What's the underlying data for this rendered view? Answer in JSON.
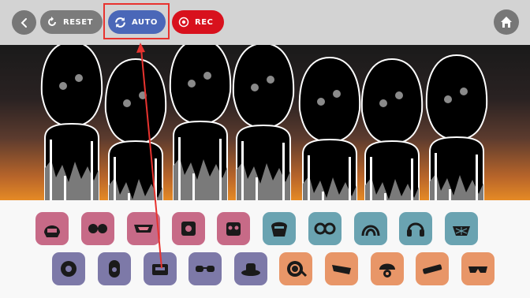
{
  "toolbar": {
    "back_icon": "chevron-left-icon",
    "reset_label": "RESET",
    "auto_label": "AUTO",
    "rec_label": "REC",
    "home_icon": "home-icon"
  },
  "colors": {
    "toolbar_bg": "#d3d3d3",
    "reset_btn": "#7b7b7b",
    "auto_btn": "#4a67b8",
    "rec_btn": "#d8111d",
    "annotation": "#e8332f"
  },
  "characters": 7,
  "palette": {
    "row1": [
      {
        "icon": "helmet-icon",
        "color": "pink"
      },
      {
        "icon": "goggles-icon",
        "color": "pink"
      },
      {
        "icon": "visor-icon",
        "color": "pink"
      },
      {
        "icon": "gear-face-icon",
        "color": "pink"
      },
      {
        "icon": "robot-face-icon",
        "color": "pink"
      },
      {
        "icon": "mask-icon",
        "color": "teal"
      },
      {
        "icon": "swim-goggles-icon",
        "color": "teal"
      },
      {
        "icon": "wave-hood-icon",
        "color": "teal"
      },
      {
        "icon": "headphones-icon",
        "color": "teal"
      },
      {
        "icon": "mesh-mask-icon",
        "color": "teal"
      }
    ],
    "row2": [
      {
        "icon": "round-head-icon",
        "color": "purple"
      },
      {
        "icon": "capsule-head-icon",
        "color": "purple"
      },
      {
        "icon": "box-head-icon",
        "color": "purple"
      },
      {
        "icon": "glasses-icon",
        "color": "purple"
      },
      {
        "icon": "hat-icon",
        "color": "purple"
      },
      {
        "icon": "speaker-head-icon",
        "color": "orange"
      },
      {
        "icon": "shades-icon",
        "color": "orange"
      },
      {
        "icon": "cap-icon",
        "color": "orange"
      },
      {
        "icon": "pipe-icon",
        "color": "orange"
      },
      {
        "icon": "sunglasses-icon",
        "color": "orange"
      }
    ]
  }
}
